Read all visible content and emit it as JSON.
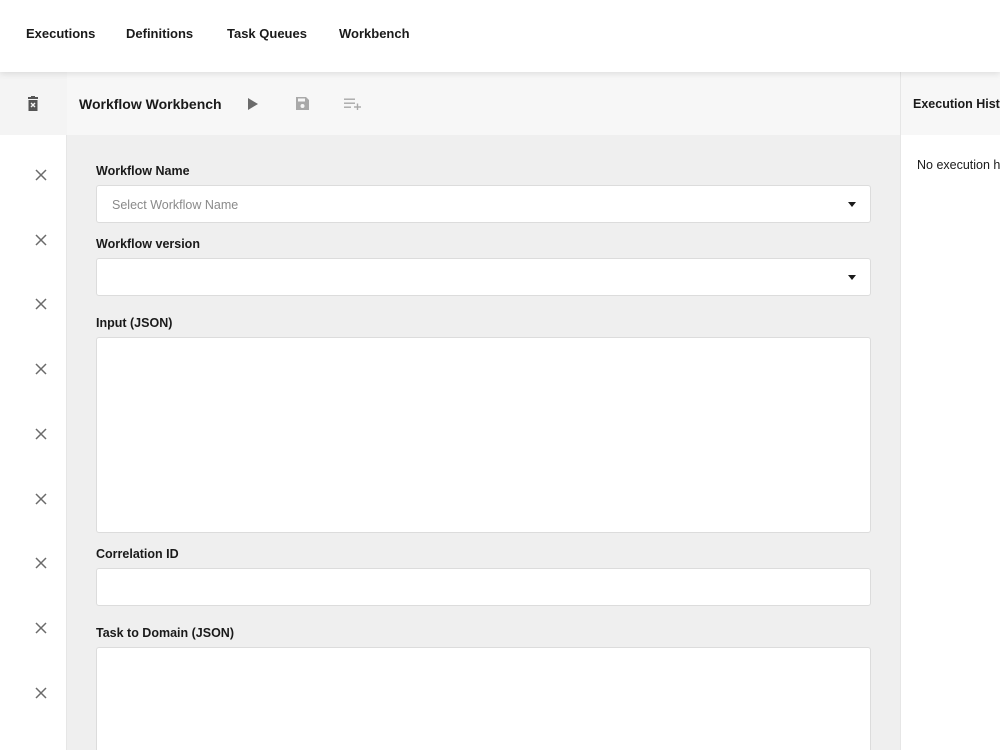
{
  "nav": {
    "items": [
      {
        "label": "Executions"
      },
      {
        "label": "Definitions"
      },
      {
        "label": "Task Queues"
      },
      {
        "label": "Workbench"
      }
    ]
  },
  "left_column": {
    "icons": {
      "clear": "trash-icon",
      "remove": "close-icon"
    },
    "remove_count": 9
  },
  "toolbar": {
    "title": "Workflow Workbench",
    "icons": [
      "play-icon",
      "save-icon",
      "playlist-add-icon"
    ]
  },
  "form": {
    "workflow_name": {
      "label": "Workflow Name",
      "placeholder": "Select Workflow Name"
    },
    "workflow_version": {
      "label": "Workflow version",
      "value": ""
    },
    "input_json": {
      "label": "Input (JSON)",
      "value": ""
    },
    "correlation_id": {
      "label": "Correlation ID",
      "value": ""
    },
    "task_to_domain": {
      "label": "Task to Domain (JSON)",
      "value": ""
    }
  },
  "history": {
    "title": "Execution History",
    "empty": "No execution history"
  },
  "colors": {
    "background": "#efefef",
    "toolbar": "#f7f7f7",
    "icon_gray": "#6b6b6b",
    "icon_light": "#a9a9a9"
  }
}
